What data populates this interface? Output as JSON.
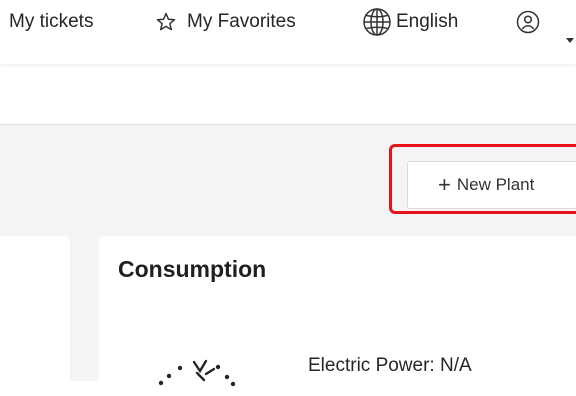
{
  "header": {
    "my_tickets": "My tickets",
    "my_favorites": "My Favorites",
    "language": "English"
  },
  "toolbar": {
    "new_plant_label": "New Plant",
    "new_plant_icon": "plus-icon"
  },
  "consumption_card": {
    "title": "Consumption",
    "electric_power_label": "Electric Power: N/A",
    "icon": "electric-power-icon"
  },
  "icons": {
    "favorites": "star-icon",
    "language": "globe-icon",
    "user": "user-avatar-icon",
    "dropdown": "caret-down-icon"
  },
  "colors": {
    "highlight": "#e8121b",
    "background_gray": "#f4f4f5"
  }
}
